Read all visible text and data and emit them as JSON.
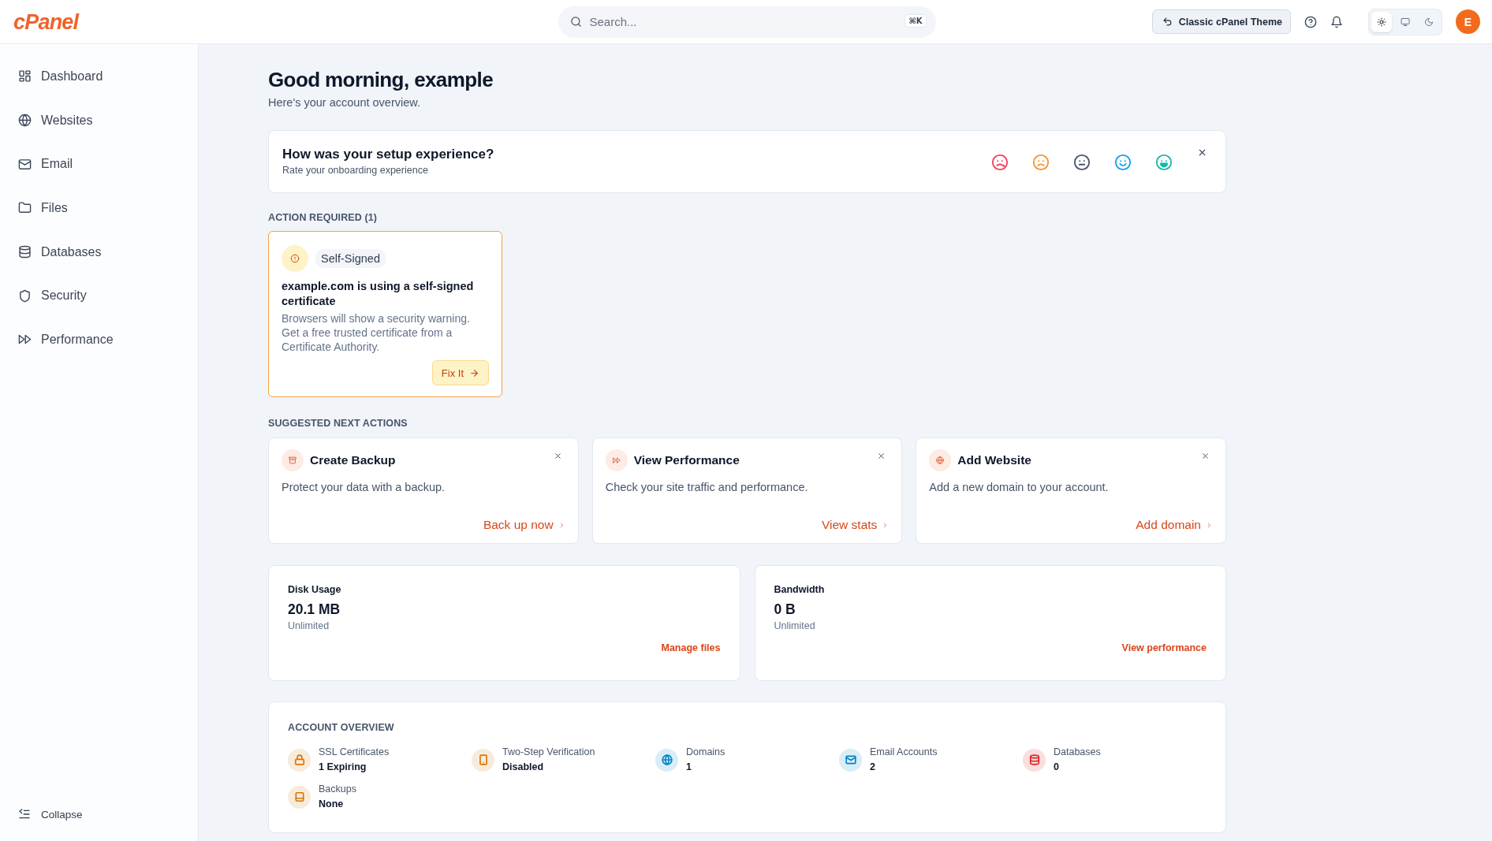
{
  "header": {
    "logo": "cPanel",
    "search": {
      "placeholder": "Search...",
      "shortcut": "⌘K"
    },
    "theme_button": "Classic cPanel Theme",
    "theme_modes": [
      {
        "kind": "light",
        "selected": true
      },
      {
        "kind": "system",
        "selected": false
      },
      {
        "kind": "dark",
        "selected": false
      }
    ],
    "avatar": "E"
  },
  "sidebar": {
    "items": [
      {
        "label": "Dashboard"
      },
      {
        "label": "Websites"
      },
      {
        "label": "Email"
      },
      {
        "label": "Files"
      },
      {
        "label": "Databases"
      },
      {
        "label": "Security"
      },
      {
        "label": "Performance"
      }
    ],
    "collapse": "Collapse"
  },
  "greeting": {
    "title": "Good morning, example",
    "subtitle": "Here's your account overview."
  },
  "feedback": {
    "title": "How was your setup experience?",
    "subtitle": "Rate your onboarding experience",
    "faces": [
      {
        "kind": "awful",
        "color": "#f43f5e"
      },
      {
        "kind": "bad",
        "color": "#f7932f"
      },
      {
        "kind": "neutral",
        "color": "#475569"
      },
      {
        "kind": "good",
        "color": "#0ea5e9"
      },
      {
        "kind": "great",
        "color": "#14b8a6"
      }
    ]
  },
  "action_required": {
    "heading": "ACTION REQUIRED (1)",
    "cards": [
      {
        "badge": "Self-Signed",
        "title": "example.com is using a self-signed certificate",
        "description": "Browsers will show a security warning. Get a free trusted certificate from a Certificate Authority.",
        "button": "Fix It"
      }
    ]
  },
  "suggested": {
    "heading": "SUGGESTED NEXT ACTIONS",
    "cards": [
      {
        "title": "Create Backup",
        "description": "Protect your data with a backup.",
        "link": "Back up now"
      },
      {
        "title": "View Performance",
        "description": "Check your site traffic and performance.",
        "link": "View stats"
      },
      {
        "title": "Add Website",
        "description": "Add a new domain to your account.",
        "link": "Add domain"
      }
    ]
  },
  "stats": [
    {
      "title": "Disk Usage",
      "value": "20.1 MB",
      "limit": "Unlimited",
      "link": "Manage files"
    },
    {
      "title": "Bandwidth",
      "value": "0 B",
      "limit": "Unlimited",
      "link": "View performance"
    }
  ],
  "account_overview": {
    "heading": "ACCOUNT OVERVIEW",
    "items": [
      {
        "label": "SSL Certificates",
        "value": "1 Expiring",
        "color": "#d97706"
      },
      {
        "label": "Two-Step Verification",
        "value": "Disabled",
        "color": "#d97706"
      },
      {
        "label": "Domains",
        "value": "1",
        "color": "#0284c7"
      },
      {
        "label": "Email Accounts",
        "value": "2",
        "color": "#0284c7"
      },
      {
        "label": "Databases",
        "value": "0",
        "color": "#dc2626"
      },
      {
        "label": "Backups",
        "value": "None",
        "color": "#d97706"
      }
    ]
  }
}
